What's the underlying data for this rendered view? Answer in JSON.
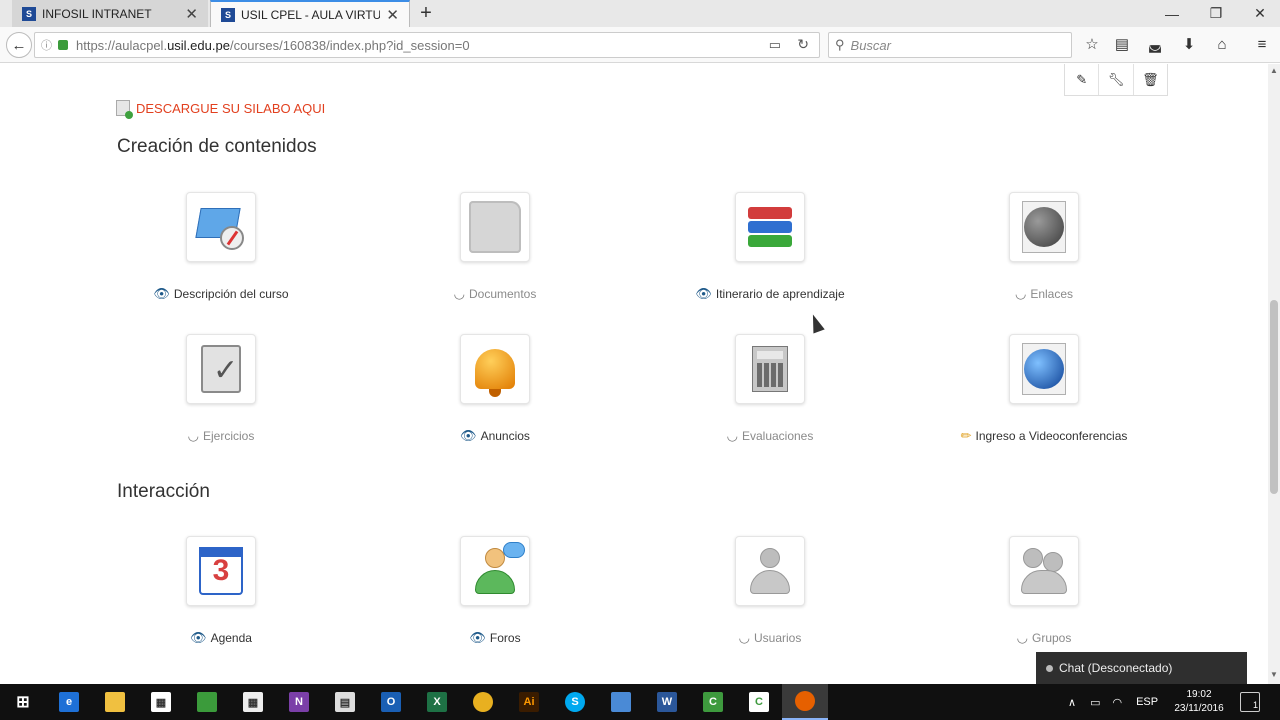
{
  "browser": {
    "tabs": [
      {
        "label": "INFOSIL INTRANET",
        "favicon": "S"
      },
      {
        "label": "USIL CPEL - AULA VIRTUA...",
        "favicon": "S"
      }
    ],
    "window_controls": {
      "minimize": "—",
      "maximize": "❐",
      "close": "✕"
    },
    "url": {
      "host": "https://aulacpel.",
      "domain": "usil.edu.pe",
      "path": "/courses/160838/index.php?id_session=0"
    },
    "search_placeholder": "Buscar"
  },
  "course": {
    "silabo_link": "DESCARGUE SU SILABO AQUI",
    "sections": [
      {
        "title": "Creación de contenidos",
        "tools": [
          {
            "label": "Descripción del curso",
            "visible": true,
            "icon": "compass-map-icon"
          },
          {
            "label": "Documentos",
            "visible": false,
            "icon": "folder-icon"
          },
          {
            "label": "Itinerario de aprendizaje",
            "visible": true,
            "icon": "books-icon"
          },
          {
            "label": "Enlaces",
            "visible": false,
            "icon": "globe-document-icon"
          },
          {
            "label": "Ejercicios",
            "visible": false,
            "icon": "clipboard-check-icon"
          },
          {
            "label": "Anuncios",
            "visible": true,
            "icon": "bell-icon"
          },
          {
            "label": "Evaluaciones",
            "visible": false,
            "icon": "calculator-icon"
          },
          {
            "label": "Ingreso a Videoconferencias",
            "visible": true,
            "icon": "blue-globe-document-icon",
            "edit_mode": true
          }
        ]
      },
      {
        "title": "Interacción",
        "tools": [
          {
            "label": "Agenda",
            "visible": true,
            "icon": "calendar-icon"
          },
          {
            "label": "Foros",
            "visible": true,
            "icon": "forum-user-icon"
          },
          {
            "label": "Usuarios",
            "visible": false,
            "icon": "user-icon"
          },
          {
            "label": "Grupos",
            "visible": false,
            "icon": "group-icon"
          }
        ]
      }
    ]
  },
  "chat": {
    "label": "Chat (Desconectado)"
  },
  "taskbar": {
    "language": "ESP",
    "time": "19:02",
    "date": "23/11/2016",
    "notification_count": "1"
  }
}
